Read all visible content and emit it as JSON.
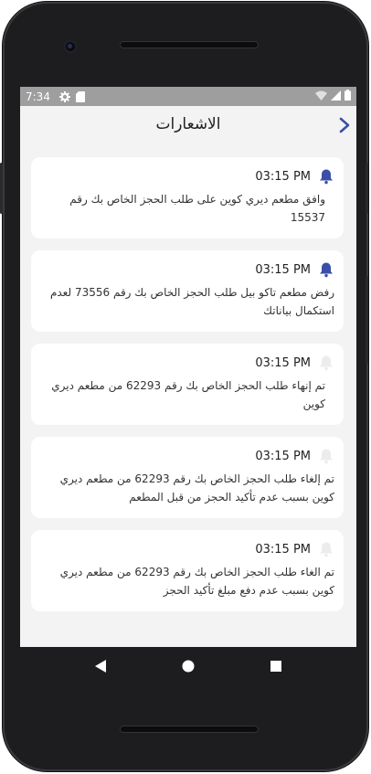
{
  "status_bar": {
    "time": "7:34",
    "icons": [
      "gear-icon",
      "sd-card-icon",
      "wifi-icon",
      "signal-icon",
      "battery-icon"
    ]
  },
  "app_bar": {
    "title": "الاشعارات",
    "back_icon": "chevron-right-icon"
  },
  "colors": {
    "accent": "#3b4fa8",
    "bell_read": "#ececec",
    "card_bg": "#ffffff",
    "screen_bg": "#f3f3f3",
    "status_bar_bg": "#9e9e9e"
  },
  "notifications": [
    {
      "time": "03:15 PM",
      "message": "وافق مطعم ديري كوين على طلب الحجز الخاص بك رقم 15537",
      "unread": true
    },
    {
      "time": "03:15 PM",
      "message": "رفض مطعم تاكو بيل طلب الحجز الخاص بك رقم 73556 لعدم استكمال بياناتك",
      "unread": true
    },
    {
      "time": "03:15 PM",
      "message": "تم إنهاء طلب الحجز الخاص بك رقم 62293 من مطعم ديري كوين",
      "unread": false
    },
    {
      "time": "03:15 PM",
      "message": "تم إلغاء طلب الحجز الخاص بك رقم 62293 من مطعم ديري كوين بسبب عدم تأكيد الحجز من قبل المطعم",
      "unread": false
    },
    {
      "time": "03:15 PM",
      "message": "تم الغاء طلب الحجز الخاص بك رقم 62293 من مطعم ديري كوين بسبب عدم دفع مبلغ تأكيد الحجز",
      "unread": false
    }
  ],
  "nav_bar": {
    "buttons": [
      "back-triangle-icon",
      "home-circle-icon",
      "recents-square-icon"
    ]
  }
}
